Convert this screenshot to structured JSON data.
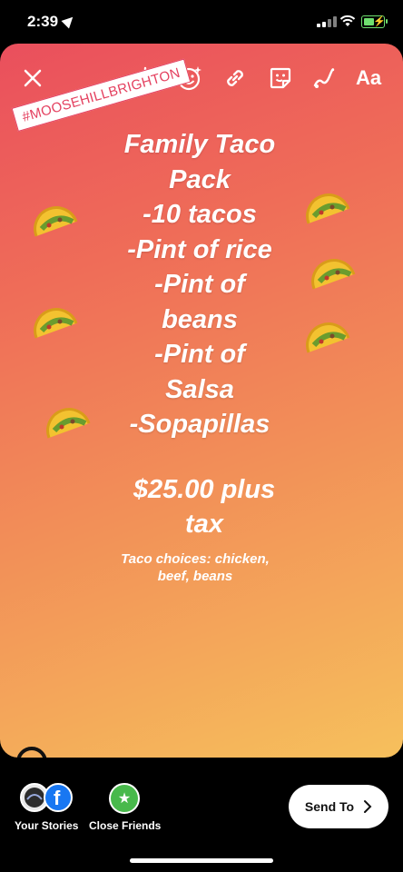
{
  "status_bar": {
    "time": "2:39"
  },
  "story": {
    "hashtag": "#MOOSEHILLBRIGHTON",
    "title_lines": [
      "Family Taco",
      "Pack",
      "-10 tacos",
      "-Pint of rice",
      "-Pint of",
      "beans",
      "-Pint of",
      "Salsa",
      "-Sopapillas"
    ],
    "price_lines": [
      "$25.00 plus",
      "tax"
    ],
    "choices_lines": [
      "Taco choices: chicken,",
      "beef, beans"
    ]
  },
  "toolbar": {
    "close_icon": "close-icon",
    "download_icon": "download-icon",
    "effects_icon": "face-effects-icon",
    "link_icon": "link-icon",
    "sticker_icon": "sticker-icon",
    "draw_icon": "draw-icon",
    "text_label": "Aa"
  },
  "share_bar": {
    "your_stories": "Your Stories",
    "close_friends": "Close Friends",
    "send_to": "Send To"
  },
  "colors": {
    "gradient_top": "#ea4f5d",
    "gradient_bottom": "#f6c05c",
    "hashtag_color": "#e4405f",
    "close_friends_green": "#48b94b",
    "facebook_blue": "#1877f2"
  }
}
